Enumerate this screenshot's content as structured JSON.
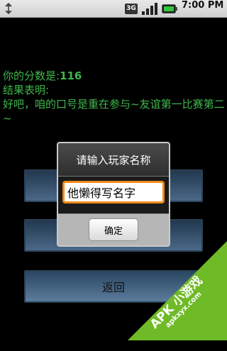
{
  "status_bar": {
    "network": "3G",
    "time": "7:00 PM"
  },
  "result": {
    "score_label": "你的分数是:",
    "score_value": "116",
    "summary_label": "结果表明:",
    "message": "好吧，咱的口号是重在参与~友谊第一比赛第二~"
  },
  "buttons": {
    "back_label": "返回"
  },
  "dialog": {
    "title": "请输入玩家名称",
    "input_value": "他懒得写名字",
    "ok_label": "确定"
  },
  "watermark": {
    "main": "APK 小游戏",
    "sub": "apkxyx.com"
  },
  "colors": {
    "text_green": "#3fb74c",
    "accent_orange": "#f08a17",
    "watermark_green": "#6fbb27"
  }
}
